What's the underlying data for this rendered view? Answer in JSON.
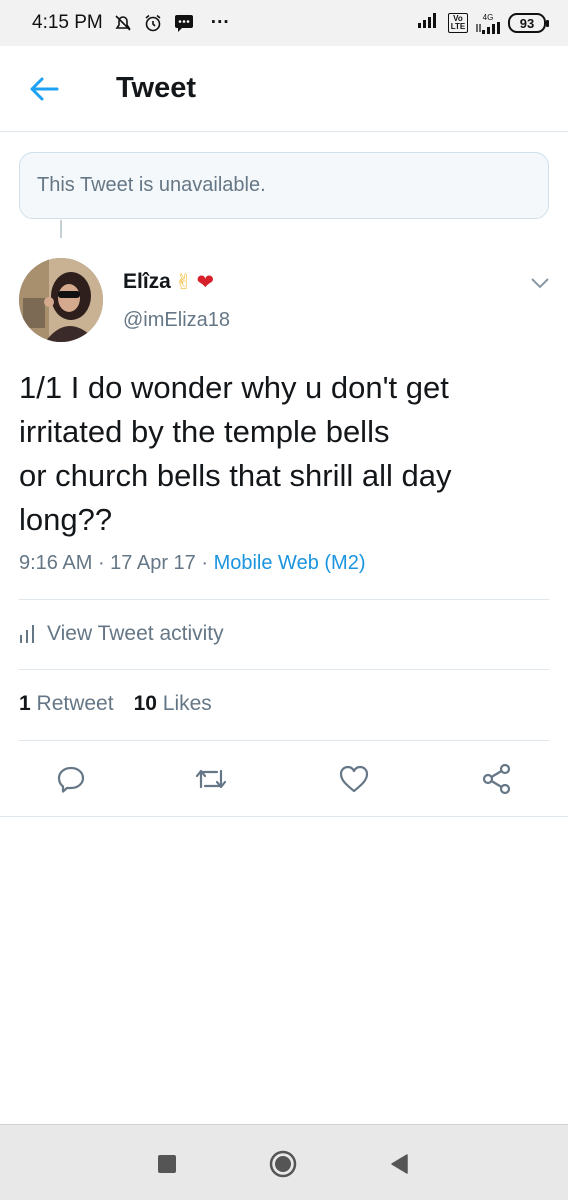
{
  "status_bar": {
    "time": "4:15 PM",
    "left_icons": [
      "mute-icon",
      "alarm-icon",
      "message-icon"
    ],
    "more": "···",
    "volte_top": "Vo",
    "volte_bottom": "LTE",
    "network": "4G",
    "battery": "93"
  },
  "header": {
    "title": "Tweet",
    "accent": "#1da1f2"
  },
  "unavailable": {
    "text": "This Tweet is unavailable."
  },
  "tweet": {
    "author_name": "Elîza",
    "author_emoji_1": "✌",
    "author_emoji_2": "❤",
    "handle": "@imEliza18",
    "text": "1/1 I do wonder why u don't get\nirritated by the temple bells\nor church bells that shrill all day\nlong??",
    "time": "9:16 AM",
    "date": "17 Apr 17",
    "source": "Mobile Web (M2)",
    "separator": " · ",
    "activity_label": "View Tweet activity",
    "retweets_count": "1",
    "retweets_label": "Retweet",
    "likes_count": "10",
    "likes_label": "Likes"
  },
  "actions": [
    "reply-icon",
    "retweet-icon",
    "like-icon",
    "share-icon"
  ],
  "colors": {
    "link": "#1b95e0",
    "secondary_text": "#657786",
    "divider": "#e1e8ed"
  }
}
